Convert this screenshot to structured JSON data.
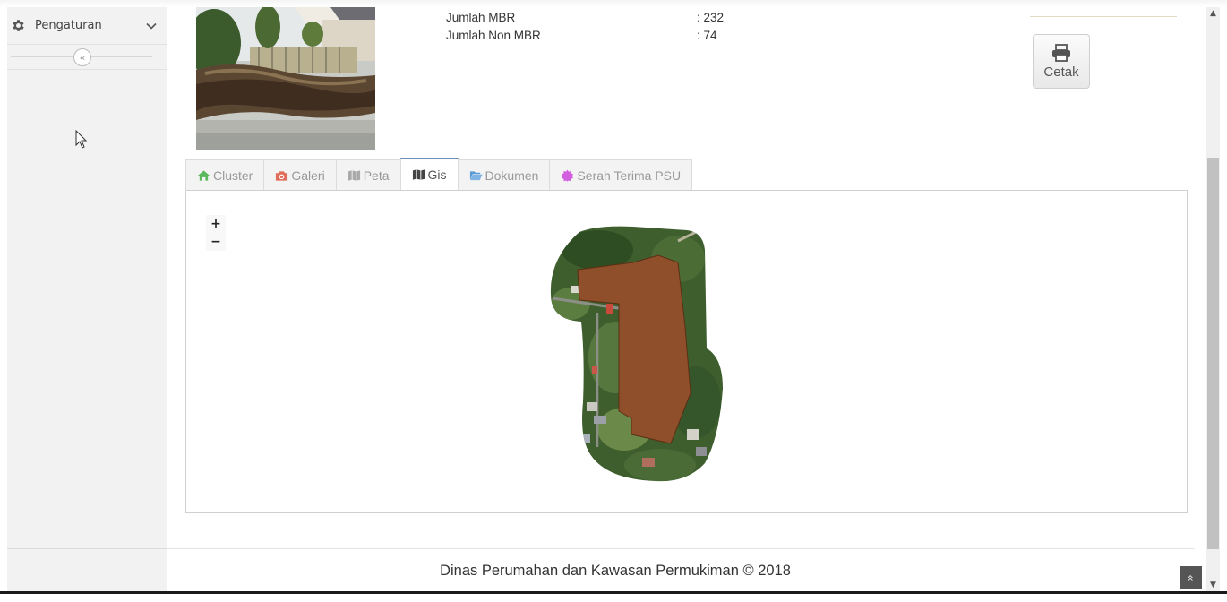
{
  "sidebar": {
    "menu_label": "Pengaturan",
    "icons": {
      "menu": "gear-icon",
      "menu_chevron": "chevron-down-icon",
      "collapse": "double-chevron-left-icon"
    }
  },
  "info": {
    "rows": [
      {
        "label": "Jumlah MBR",
        "value": ": 232"
      },
      {
        "label": "Jumlah Non MBR",
        "value": ": 74"
      }
    ]
  },
  "actions": {
    "print_label": "Cetak",
    "print_icon": "printer-icon"
  },
  "tabs": [
    {
      "label": "Cluster",
      "icon": "home-icon",
      "color": "#5cb85c"
    },
    {
      "label": "Galeri",
      "icon": "camera-icon",
      "color": "#e06c5a"
    },
    {
      "label": "Peta",
      "icon": "map-icon",
      "color": "#aaaaaa"
    },
    {
      "label": "Gis",
      "icon": "map-icon",
      "color": "#444444",
      "active": true
    },
    {
      "label": "Dokumen",
      "icon": "folder-open-icon",
      "color": "#5b9bd5"
    },
    {
      "label": "Serah Terima PSU",
      "icon": "certificate-icon",
      "color": "#d35ee0"
    }
  ],
  "map": {
    "zoom_in": "+",
    "zoom_out": "−",
    "parcel_color": "#8f4f2a"
  },
  "footer": {
    "text": "Dinas Perumahan dan Kawasan Permukiman © 2018"
  },
  "scroll_top": "«"
}
